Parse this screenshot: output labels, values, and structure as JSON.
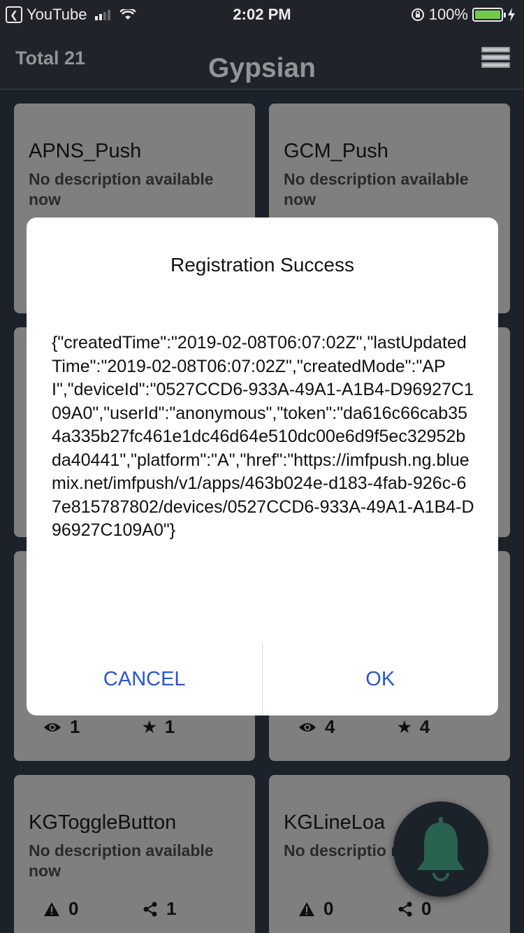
{
  "status_bar": {
    "back_app": "YouTube",
    "time": "2:02 PM",
    "battery": "100%"
  },
  "header": {
    "total": "Total 21",
    "title": "Gypsian",
    "menu_icon": "stacked-list-icon"
  },
  "cards": [
    {
      "name": "APNS_Push",
      "description": "No description available now"
    },
    {
      "name": "GCM_Push",
      "description": "No description available now"
    },
    {
      "name": "",
      "description": "",
      "views": "1",
      "stars": "1"
    },
    {
      "name": "",
      "description": "",
      "views": "4",
      "stars": "4"
    },
    {
      "name": "KGToggleButton",
      "description": "No description available now",
      "issues": "0",
      "shares": "1"
    },
    {
      "name": "KGLineLoa",
      "description": "No descriptio now",
      "issues": "0",
      "shares": "0"
    }
  ],
  "fab": {
    "icon": "bell-icon",
    "color": "#2d6b57"
  },
  "dialog": {
    "title": "Registration Success",
    "message": "{\"createdTime\":\"2019-02-08T06:07:02Z\",\"lastUpdatedTime\":\"2019-02-08T06:07:02Z\",\"createdMode\":\"API\",\"deviceId\":\"0527CCD6-933A-49A1-A1B4-D96927C109A0\",\"userId\":\"anonymous\",\"token\":\"da616c66cab354a335b27fc461e1dc46d64e510dc00e6d9f5ec32952bda40441\",\"platform\":\"A\",\"href\":\"https://imfpush.ng.bluemix.net/imfpush/v1/apps/463b024e-d183-4fab-926c-67e815787802/devices/0527CCD6-933A-49A1-A1B4-D96927C109A0\"}",
    "cancel_label": "CANCEL",
    "ok_label": "OK"
  }
}
